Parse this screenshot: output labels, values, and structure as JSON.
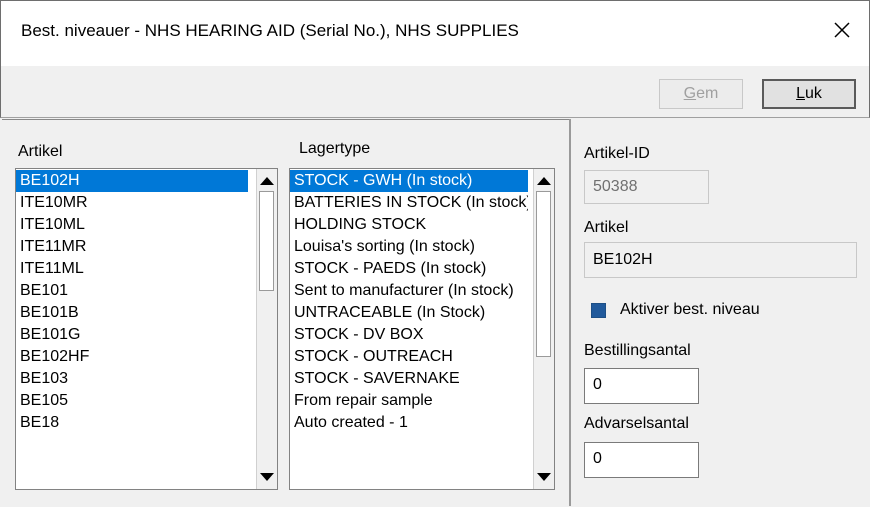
{
  "window": {
    "title": "Best. niveauer - NHS HEARING AID (Serial No.), NHS SUPPLIES",
    "close_icon": "close-icon"
  },
  "toolbar": {
    "save_label": "Gem",
    "save_enabled": false,
    "close_label": "Luk"
  },
  "artikel_list": {
    "label": "Artikel",
    "selected_index": 0,
    "items": [
      "BE102H",
      "ITE10MR",
      "ITE10ML",
      "ITE11MR",
      "ITE11ML",
      "BE101",
      "BE101B",
      "BE101G",
      "BE102HF",
      "BE103",
      "BE105",
      "BE18"
    ]
  },
  "lagertype_list": {
    "label": "Lagertype",
    "selected_index": 0,
    "items": [
      "STOCK - GWH (In stock)",
      "BATTERIES IN STOCK (In stock)",
      "HOLDING STOCK",
      "Louisa's sorting (In stock)",
      "STOCK - PAEDS (In stock)",
      "Sent to manufacturer (In stock)",
      "UNTRACEABLE (In Stock)",
      "STOCK - DV BOX",
      "STOCK - OUTREACH",
      "STOCK - SAVERNAKE",
      "From repair sample",
      "Auto created - 1"
    ]
  },
  "details": {
    "artikel_id_label": "Artikel-ID",
    "artikel_id_value": "50388",
    "artikel_label": "Artikel",
    "artikel_value": "BE102H",
    "aktiver_label": "Aktiver best. niveau",
    "aktiver_checked": true,
    "bestillingsantal_label": "Bestillingsantal",
    "bestillingsantal_value": "0",
    "advarselsantal_label": "Advarselsantal",
    "advarselsantal_value": "0"
  }
}
